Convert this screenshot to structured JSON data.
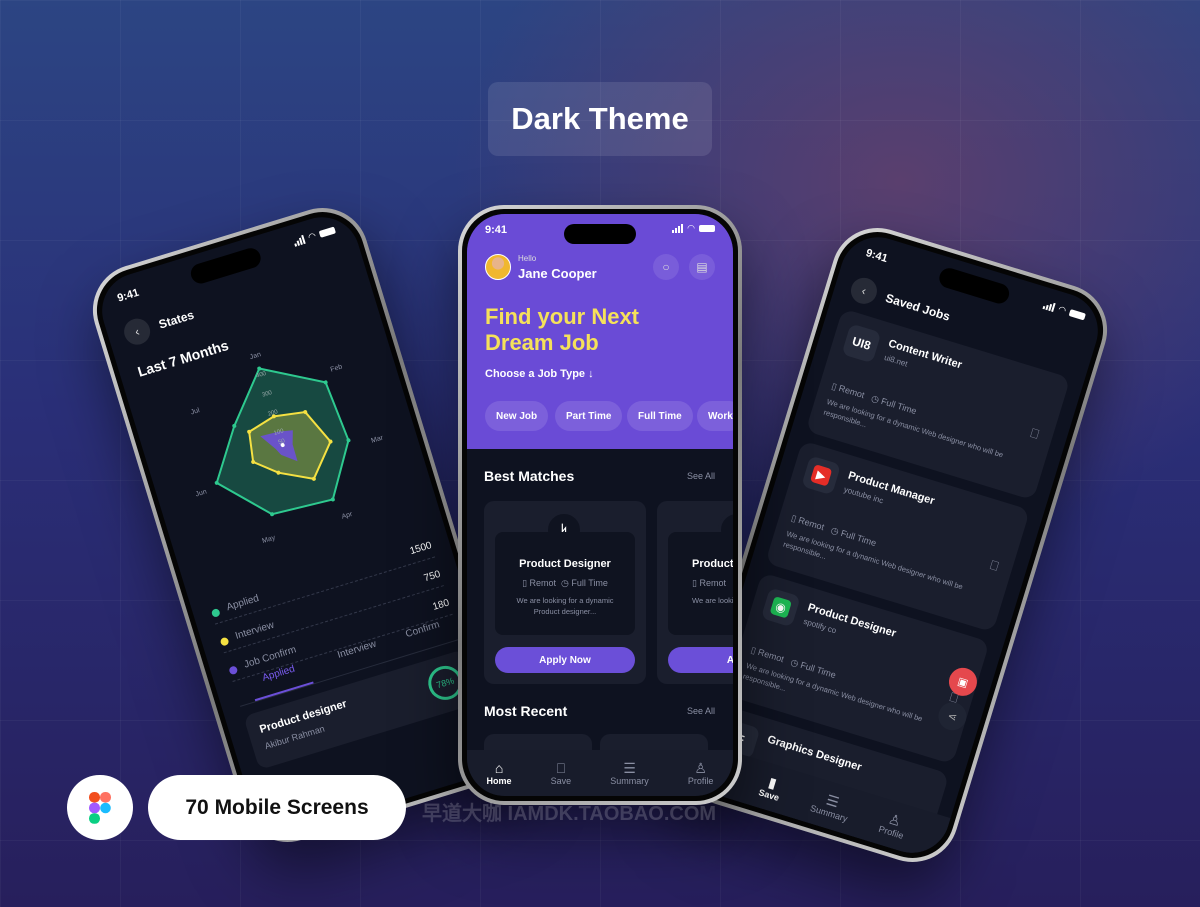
{
  "title": "Dark Theme",
  "badge": "70 Mobile Screens",
  "watermark": "早道大咖 IAMDK.TAOBAO.COM",
  "colors": {
    "accent": "#6b4fd8",
    "headline": "#f5e15a",
    "applied": "#2ec98f",
    "interview": "#f5e142",
    "confirm": "#6b4fd8",
    "danger": "#e5484d"
  },
  "home": {
    "time": "9:41",
    "greeting": "Hello",
    "user": "Jane Cooper",
    "headline": [
      "Find your Next",
      "Dream Job"
    ],
    "choose": "Choose a Job Type ↓",
    "chips": [
      "New Job",
      "Part Time",
      "Full Time",
      "Work"
    ],
    "best_matches": "Best Matches",
    "see_all": "See All",
    "cards": [
      {
        "title": "Product Designer",
        "location": "Remot",
        "type": "Full Time",
        "desc": "We are looking for a dynamic Product designer...",
        "cta": "Apply Now"
      },
      {
        "title": "Product",
        "location": "Remot",
        "type": "",
        "desc": "We are lookin Product",
        "cta": "Appl"
      }
    ],
    "most_recent": "Most Recent",
    "nav": [
      "Home",
      "Save",
      "Summary",
      "Profile"
    ]
  },
  "stats": {
    "time": "9:41",
    "title": "States",
    "period": "Last 7 Months",
    "axes": [
      "Jan",
      "Feb",
      "Mar",
      "Apr",
      "May",
      "Jun",
      "Jul"
    ],
    "ticks": [
      "400",
      "300",
      "200",
      "100",
      "50"
    ],
    "radar": {
      "max": 400,
      "series": [
        {
          "name": "Applied",
          "values": [
            400,
            380,
            330,
            370,
            350,
            380,
            260
          ]
        },
        {
          "name": "Interview",
          "values": [
            150,
            200,
            240,
            230,
            140,
            170,
            180
          ]
        },
        {
          "name": "Job Confirm",
          "values": [
            70,
            90,
            50,
            110,
            50,
            40,
            120
          ]
        }
      ]
    },
    "legend": [
      {
        "label": "Applied",
        "value": "1500"
      },
      {
        "label": "Interview",
        "value": "750"
      },
      {
        "label": "Job Confirm",
        "value": "180"
      }
    ],
    "tabs": [
      "Applied",
      "Interview",
      "Confirm"
    ],
    "item": {
      "title": "Product designer",
      "name": "Akibur Rahman",
      "percent": "78%"
    }
  },
  "saved": {
    "time": "9:41",
    "title": "Saved Jobs",
    "jobs": [
      {
        "title": "Content Writer",
        "company": "ui8.net",
        "logo": "UI8",
        "location": "Remot",
        "type": "Full Time",
        "desc": "We are looking for a dynamic Web designer who will be responsible..."
      },
      {
        "title": "Product Manager",
        "company": "youtube inc",
        "logo": "▶",
        "location": "Remot",
        "type": "Full Time",
        "desc": "We are looking for a dynamic Web designer who will be responsible..."
      },
      {
        "title": "Product Designer",
        "company": "spotify co",
        "logo": "◉",
        "location": "Remot",
        "type": "Full Time",
        "desc": "We are looking for a dynamic Web designer who will be responsible..."
      },
      {
        "title": "Graphics Designer",
        "company": "",
        "logo": "F",
        "location": "",
        "type": "",
        "desc": ""
      }
    ],
    "nav": [
      "Save",
      "Summary",
      "Profile"
    ]
  }
}
